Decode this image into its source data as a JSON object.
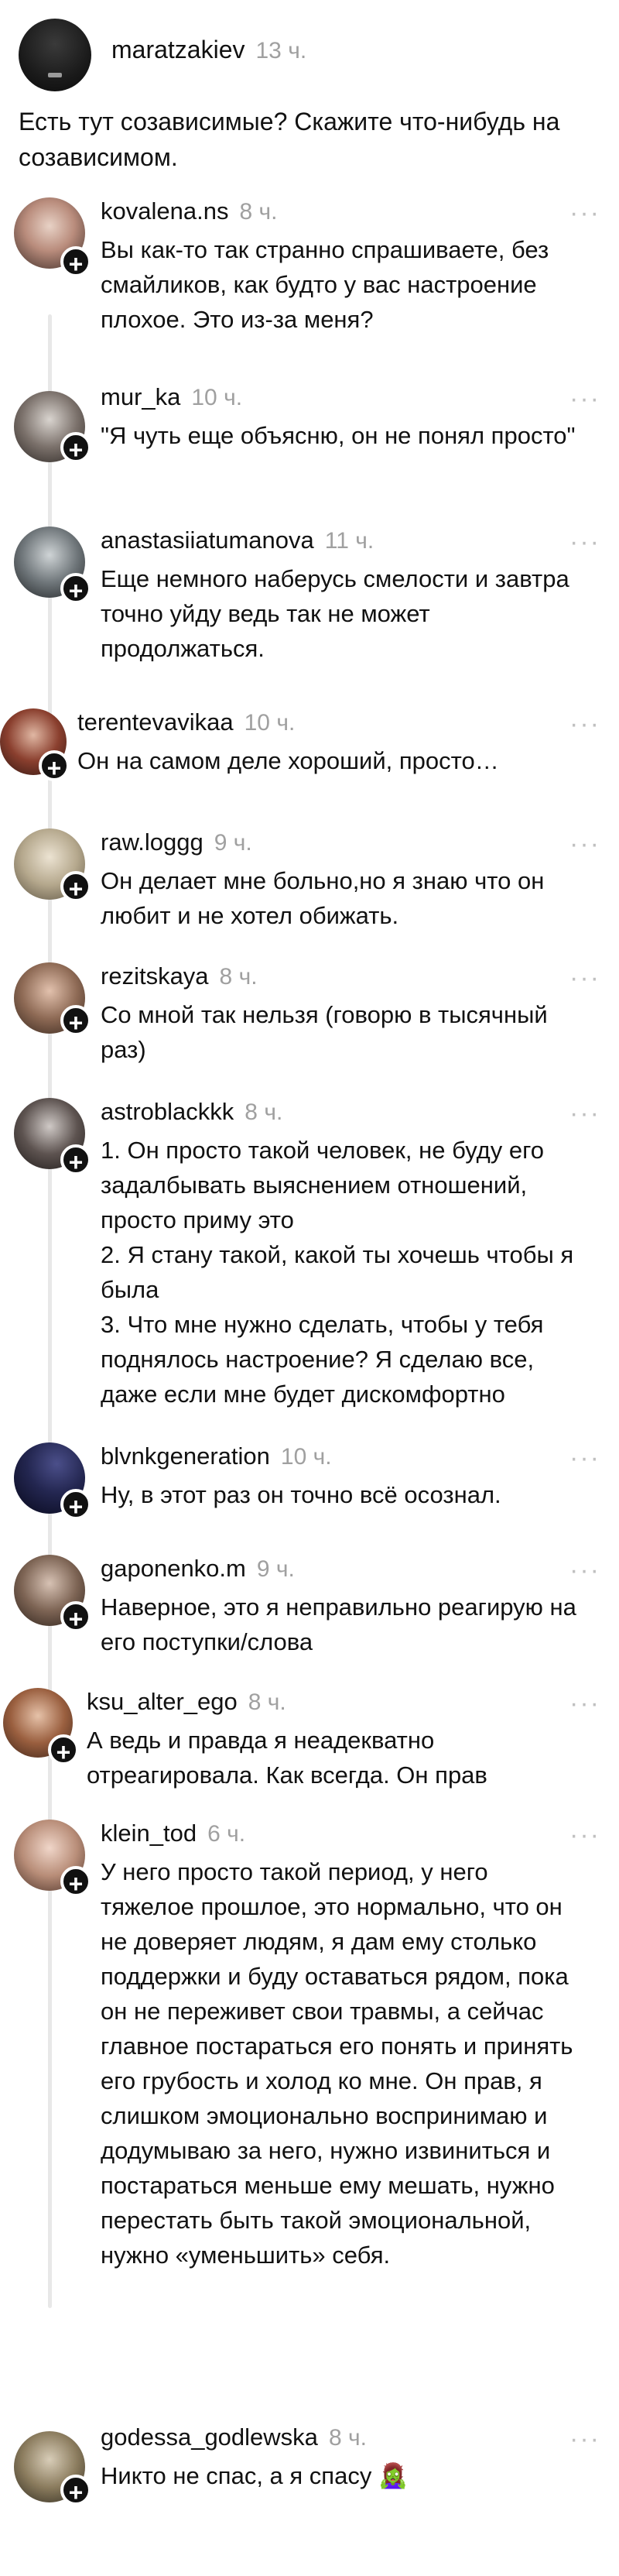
{
  "post": {
    "author": "maratzakiev",
    "time": "13 ч.",
    "text": "Есть тут созависимые? Скажите что-нибудь на созависимом."
  },
  "more_label": "···",
  "plus_label": "+",
  "comments": [
    {
      "author": "kovalena.ns",
      "time": "8 ч.",
      "text": "Вы как-то так странно спрашиваете, без смайликов, как будто у вас настроение плохое. Это из-за меня?"
    },
    {
      "author": "mur_ka",
      "time": "10 ч.",
      "text": "\"Я чуть еще объясню, он не понял просто\""
    },
    {
      "author": "anastasiiatumanova",
      "time": "11 ч.",
      "text": "Еще немного наберусь смелости и завтра точно уйду ведь так не может продолжаться."
    },
    {
      "author": "terentevavikaa",
      "time": "10 ч.",
      "text": "Он на самом деле хороший, просто…"
    },
    {
      "author": "raw.loggg",
      "time": "9 ч.",
      "text": "Он делает мне больно,но я знаю что он любит и не хотел обижать."
    },
    {
      "author": "rezitskaya",
      "time": "8 ч.",
      "text": "Со мной так нельзя (говорю в тысячный раз)"
    },
    {
      "author": "astroblackkk",
      "time": "8 ч.",
      "text": "1. Он просто такой человек, не буду его задалбывать выяснением отношений, просто приму это\n2. Я стану такой, какой ты хочешь чтобы я была\n3. Что мне нужно сделать, чтобы у тебя поднялось настроение? Я сделаю все, даже если мне будет дискомфортно"
    },
    {
      "author": "blvnkgeneration",
      "time": "10 ч.",
      "text": "Ну, в этот раз он точно всё осознал."
    },
    {
      "author": "gaponenko.m",
      "time": "9 ч.",
      "text": "Наверное, это я неправильно реагирую на его поступки/слова"
    },
    {
      "author": "ksu_alter_ego",
      "time": "8 ч.",
      "text": "А ведь и правда я неадекватно отреагировала. Как всегда. Он прав"
    },
    {
      "author": "klein_tod",
      "time": "6 ч.",
      "text": "У него просто такой период, у него тяжелое прошлое, это нормально, что он не доверяет людям, я дам ему столько поддержки и буду оставаться рядом, пока он не переживет свои травмы, а сейчас главное постараться его понять и принять его грубость и холод ко мне. Он прав, я слишком эмоционально воспринимаю и додумываю за него, нужно извиниться и постараться меньше ему мешать, нужно перестать быть такой эмоциональной, нужно «уменьшить» себя."
    },
    {
      "author": "godessa_godlewska",
      "time": "8 ч.",
      "text": "Никто не спас, а я спасу 🧟‍♀️"
    }
  ]
}
